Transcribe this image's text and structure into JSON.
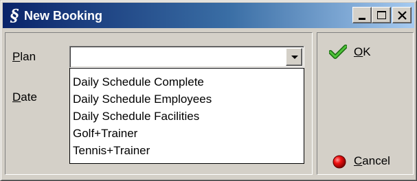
{
  "window": {
    "title": "New Booking"
  },
  "form": {
    "plan_label_mnemonic": "P",
    "plan_label_rest": "lan",
    "date_label_mnemonic": "D",
    "date_label_rest": "ate",
    "plan_value": ""
  },
  "dropdown": {
    "options": [
      "Daily Schedule Complete",
      "Daily Schedule Employees",
      "Daily Schedule Facilities",
      "Golf+Trainer",
      "Tennis+Trainer"
    ]
  },
  "buttons": {
    "ok_mnemonic": "O",
    "ok_rest": "K",
    "cancel_mnemonic": "C",
    "cancel_rest": "ancel"
  },
  "colors": {
    "title_gradient_start": "#0a246a",
    "title_gradient_end": "#a6caf0",
    "face": "#d4d0c8",
    "ok_check": "#2e9e1f",
    "cancel_dot": "#e00000"
  },
  "icons": {
    "app": "app-logo-icon",
    "minimize": "minimize-icon",
    "maximize": "maximize-icon",
    "close": "close-icon",
    "dropdown": "chevron-down-icon",
    "ok": "checkmark-icon",
    "cancel": "red-dot-icon"
  }
}
